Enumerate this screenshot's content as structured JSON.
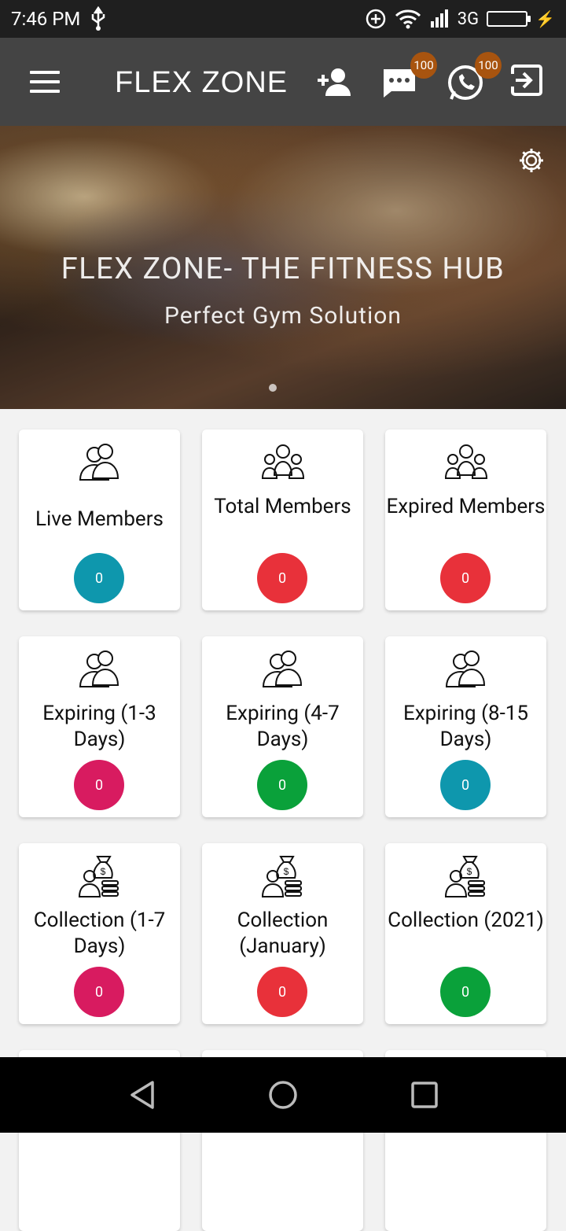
{
  "status": {
    "time": "7:46 PM",
    "network": "3G"
  },
  "app_bar": {
    "title": "FLEX ZONE",
    "messages_badge": "100",
    "whatsapp_badge": "100"
  },
  "hero": {
    "title": "FLEX ZONE- THE FITNESS HUB",
    "subtitle": "Perfect Gym Solution"
  },
  "cards": [
    {
      "label": "Live Members",
      "count": "0",
      "color": "#0e97ad",
      "icon": "members-icon"
    },
    {
      "label": "Total Members",
      "count": "0",
      "color": "#e8313a",
      "icon": "group-icon"
    },
    {
      "label": "Expired Members",
      "count": "0",
      "color": "#e8313a",
      "icon": "group-icon"
    },
    {
      "label": "Expiring (1-3 Days)",
      "count": "0",
      "color": "#d81b60",
      "icon": "members-icon"
    },
    {
      "label": "Expiring (4-7 Days)",
      "count": "0",
      "color": "#0aa13a",
      "icon": "members-icon"
    },
    {
      "label": "Expiring (8-15 Days)",
      "count": "0",
      "color": "#0e97ad",
      "icon": "members-icon"
    },
    {
      "label": "Collection (1-7 Days)",
      "count": "0",
      "color": "#d81b60",
      "icon": "money-bag-icon"
    },
    {
      "label": "Collection (January)",
      "count": "0",
      "color": "#e8313a",
      "icon": "money-bag-icon"
    },
    {
      "label": "Collection (2021)",
      "count": "0",
      "color": "#0aa13a",
      "icon": "money-bag-icon"
    }
  ]
}
